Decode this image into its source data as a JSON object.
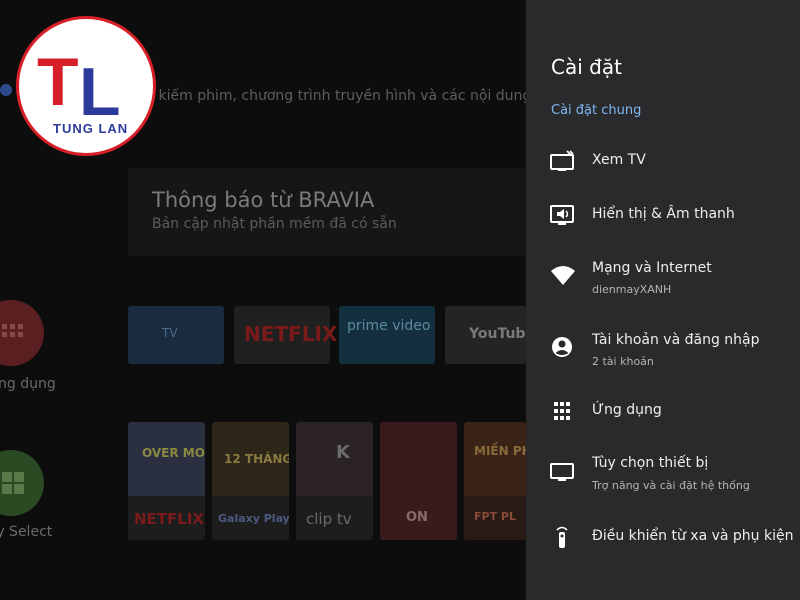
{
  "home": {
    "search_placeholder": "Tìm kiếm phim, chương trình truyền hình và các nội dung khác",
    "bravia_title": "Thông báo từ BRAVIA",
    "bravia_subtitle": "Bản cập nhật phần mềm đã có sẵn",
    "apps_label": "Ứng dụng",
    "select_label": "Sony Select",
    "channels": [
      "TV",
      "NETFLIX",
      "prime video",
      "YouTube"
    ],
    "thumbs": [
      {
        "top": "OVER MOON",
        "bottom": "NETFLIX"
      },
      {
        "top": "12 THÁNG",
        "bottom": "Galaxy Play"
      },
      {
        "top": "K",
        "bottom": "clip tv"
      },
      {
        "top": "",
        "bottom": "ON"
      },
      {
        "top": "MIỀN PH",
        "bottom": "FPT PL"
      }
    ]
  },
  "logo": {
    "initials_t": "T",
    "initials_l": "L",
    "name": "TUNG LAN"
  },
  "settings": {
    "title": "Cài đặt",
    "section": "Cài đặt chung",
    "items": [
      {
        "icon": "tv-icon",
        "label": "Xem TV",
        "sub": ""
      },
      {
        "icon": "display-sound-icon",
        "label": "Hiển thị & Âm thanh",
        "sub": ""
      },
      {
        "icon": "wifi-icon",
        "label": "Mạng và Internet",
        "sub": "dienmayXANH"
      },
      {
        "icon": "account-icon",
        "label": "Tài khoản và đăng nhập",
        "sub": "2 tài khoản"
      },
      {
        "icon": "apps-grid-icon",
        "label": "Ứng dụng",
        "sub": ""
      },
      {
        "icon": "monitor-icon",
        "label": "Tùy chọn thiết bị",
        "sub": "Trợ năng và cài đặt hệ thống"
      },
      {
        "icon": "remote-icon",
        "label": "Điều khiển từ xa và phụ kiện",
        "sub": ""
      }
    ]
  },
  "colors": {
    "accent_blue": "#7fb8f5",
    "highlight": "#f7ec14",
    "panel": "#2a2a2c",
    "logo_red": "#d61f26",
    "logo_blue": "#2b3a9b"
  }
}
